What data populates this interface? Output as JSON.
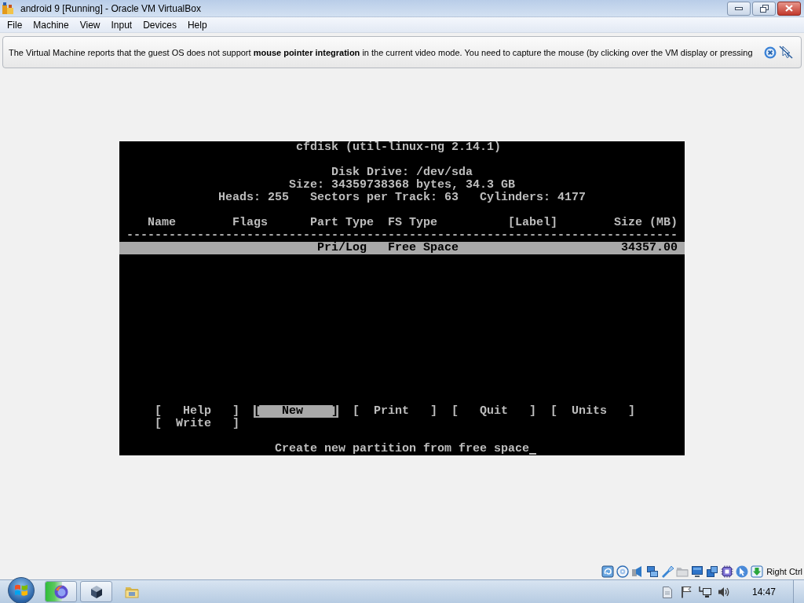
{
  "window": {
    "title": "android 9 [Running] - Oracle VM VirtualBox"
  },
  "menu_bar": [
    "File",
    "Machine",
    "View",
    "Input",
    "Devices",
    "Help"
  ],
  "notification": {
    "message": "The Virtual Machine reports that the guest OS does not support **mouse pointer integration** in the current video mode. You need to capture the mouse (by clicking over the VM display or pressing"
  },
  "console": {
    "title": "cfdisk (util-linux-ng 2.14.1)",
    "disk_drive": "Disk Drive: /dev/sda",
    "size": "Size: 34359738368 bytes, 34.3 GB",
    "geometry": [
      "Heads: 255",
      "Sectors per Track: 63",
      "Cylinders: 4177"
    ],
    "table": {
      "columns": [
        "Name",
        "Flags",
        "Part Type",
        "FS Type",
        "[Label]",
        "Size (MB)"
      ],
      "rule": "------------------------------------------------------------------------------",
      "rows": [
        {
          "part_type": "Pri/Log",
          "fs_type": "Free Space",
          "size": "34357.00",
          "selected": true
        }
      ]
    },
    "menu": [
      {
        "label": "[   Help   ]",
        "selected": false
      },
      {
        "label": "[   New    ]",
        "selected": true
      },
      {
        "label": "[  Print   ]",
        "selected": false
      },
      {
        "label": "[   Quit   ]",
        "selected": false
      },
      {
        "label": "[  Units   ]",
        "selected": false
      },
      {
        "label": "[  Write   ]",
        "selected": false
      }
    ],
    "status": {
      "message": "Create new partition from free space",
      "cursor": true
    }
  },
  "status_bar": {
    "host_key": "Right Ctrl"
  },
  "taskbar": {
    "apps": [
      {
        "kind": "swirl",
        "running": true,
        "level": 0.55
      },
      {
        "kind": "cube",
        "running": true
      },
      {
        "kind": "folder",
        "running": false
      }
    ],
    "clock": "14:47"
  }
}
